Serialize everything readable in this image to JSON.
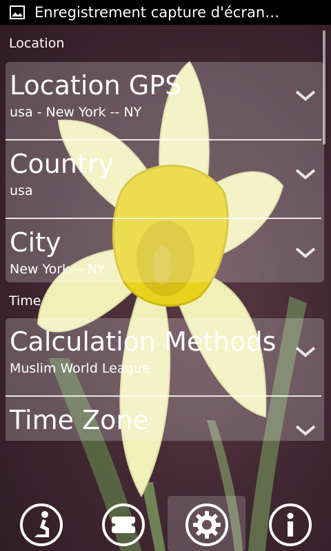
{
  "statusbar": {
    "title": "Enregistrement capture d'écran…",
    "icon": "image-icon"
  },
  "sections": [
    {
      "title": "Location",
      "items": [
        {
          "title": "Location GPS",
          "subtitle": "usa - New York -- NY"
        },
        {
          "title": "Country",
          "subtitle": "usa"
        },
        {
          "title": "City",
          "subtitle": "New York -- NY"
        }
      ]
    },
    {
      "title": "Time",
      "items": [
        {
          "title": "Calculation Methods",
          "subtitle": "Muslim World League"
        },
        {
          "title": "Time Zone",
          "subtitle": ""
        }
      ]
    }
  ],
  "bottom_nav": [
    {
      "icon": "prayer-icon",
      "active": false
    },
    {
      "icon": "book-icon",
      "active": false
    },
    {
      "icon": "gear-icon",
      "active": true
    },
    {
      "icon": "info-icon",
      "active": false
    }
  ],
  "colors": {
    "flower_petal": "#f0f0b8",
    "flower_center": "#e8d21e",
    "background": "#4a2e35"
  }
}
